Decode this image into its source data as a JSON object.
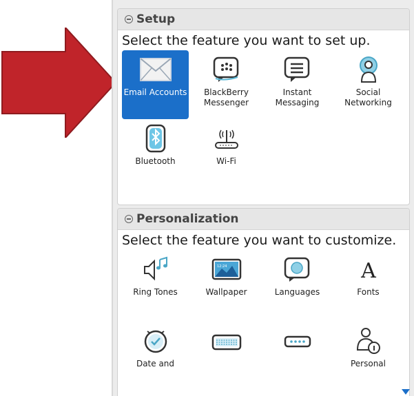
{
  "setup": {
    "title": "Setup",
    "description": "Select the feature you want to set up.",
    "items": [
      {
        "label": "Email Accounts",
        "icon": "envelope-icon",
        "selected": true
      },
      {
        "label": "BlackBerry Messenger",
        "icon": "bbm-chat-icon"
      },
      {
        "label": "Instant Messaging",
        "icon": "chat-bubble-icon"
      },
      {
        "label": "Social Networking",
        "icon": "social-network-icon"
      },
      {
        "label": "Bluetooth",
        "icon": "bluetooth-icon"
      },
      {
        "label": "Wi-Fi",
        "icon": "wifi-router-icon"
      }
    ]
  },
  "personalization": {
    "title": "Personalization",
    "description": "Select the feature you want to customize.",
    "items": [
      {
        "label": "Ring Tones",
        "icon": "ring-tones-icon"
      },
      {
        "label": "Wallpaper",
        "icon": "wallpaper-icon"
      },
      {
        "label": "Languages",
        "icon": "languages-icon"
      },
      {
        "label": "Fonts",
        "icon": "fonts-icon"
      },
      {
        "label": "Date and",
        "icon": "clock-icon"
      },
      {
        "label": "",
        "icon": "keyboard-icon"
      },
      {
        "label": "",
        "icon": "password-icon"
      },
      {
        "label": "Personal",
        "icon": "personal-info-icon"
      }
    ]
  },
  "colors": {
    "accent": "#1b6fc9",
    "arrow": "#c0242a"
  }
}
